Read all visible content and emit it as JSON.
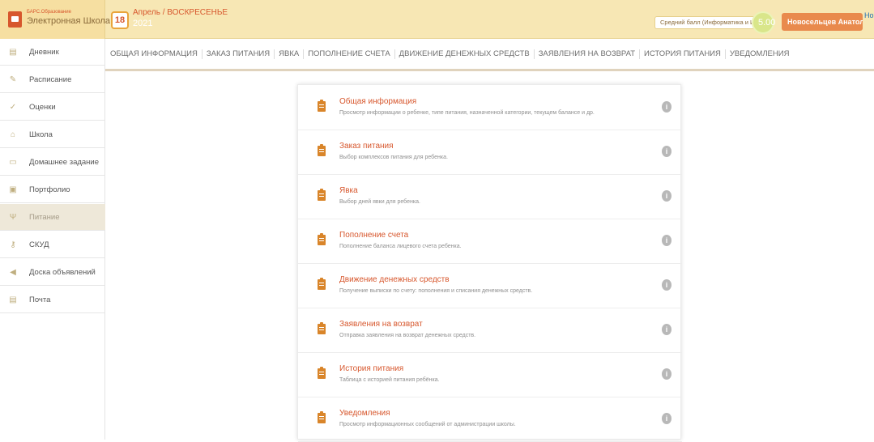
{
  "header": {
    "logo_small": "БАРС.Образование",
    "logo_big": "Электронная Школа",
    "date_day": "18",
    "date_text": "Апрель / ВОСКРЕСЕНЬЕ",
    "date_year": "2021",
    "avg_label": "Средний балл (Информатика и ИКТ)",
    "avg_value": "5.00",
    "user_name": "Новосельцев Анатолий",
    "user_image_text": "Но"
  },
  "sidebar": {
    "items": [
      {
        "label": "Дневник",
        "icon": "diary-icon"
      },
      {
        "label": "Расписание",
        "icon": "schedule-icon"
      },
      {
        "label": "Оценки",
        "icon": "checkmark-icon"
      },
      {
        "label": "Школа",
        "icon": "school-icon"
      },
      {
        "label": "Домашнее задание",
        "icon": "homework-icon"
      },
      {
        "label": "Портфолио",
        "icon": "portfolio-icon"
      },
      {
        "label": "Питание",
        "icon": "food-icon"
      },
      {
        "label": "СКУД",
        "icon": "key-icon"
      },
      {
        "label": "Доска объявлений",
        "icon": "announcement-icon"
      },
      {
        "label": "Почта",
        "icon": "mail-icon"
      }
    ],
    "active_index": 6
  },
  "tabs": [
    "ОБЩАЯ ИНФОРМАЦИЯ",
    "ЗАКАЗ ПИТАНИЯ",
    "ЯВКА",
    "ПОПОЛНЕНИЕ СЧЕТА",
    "ДВИЖЕНИЕ ДЕНЕЖНЫХ СРЕДСТВ",
    "ЗАЯВЛЕНИЯ НА ВОЗВРАТ",
    "ИСТОРИЯ ПИТАНИЯ",
    "УВЕДОМЛЕНИЯ"
  ],
  "menu": [
    {
      "title": "Общая информация",
      "desc": "Просмотр информации о ребенке, типе питания, назначенной категории, текущем балансе и др."
    },
    {
      "title": "Заказ питания",
      "desc": "Выбор комплексов питания для ребенка."
    },
    {
      "title": "Явка",
      "desc": "Выбор дней явки для ребенка."
    },
    {
      "title": "Пополнение счета",
      "desc": "Пополнение баланса лицевого счета ребенка."
    },
    {
      "title": "Движение денежных средств",
      "desc": "Получение выписки по счету: пополнения и списания денежных средств."
    },
    {
      "title": "Заявления на возврат",
      "desc": "Отправка заявления на возврат денежных средств."
    },
    {
      "title": "История питания",
      "desc": "Таблица с историей питания ребёнка."
    },
    {
      "title": "Уведомления",
      "desc": "Просмотр информационных сообщений от администрации школы."
    }
  ],
  "colors": {
    "accent": "#d7572d",
    "header_bg": "#f7e7b4",
    "icon_orange": "#d9852a"
  }
}
